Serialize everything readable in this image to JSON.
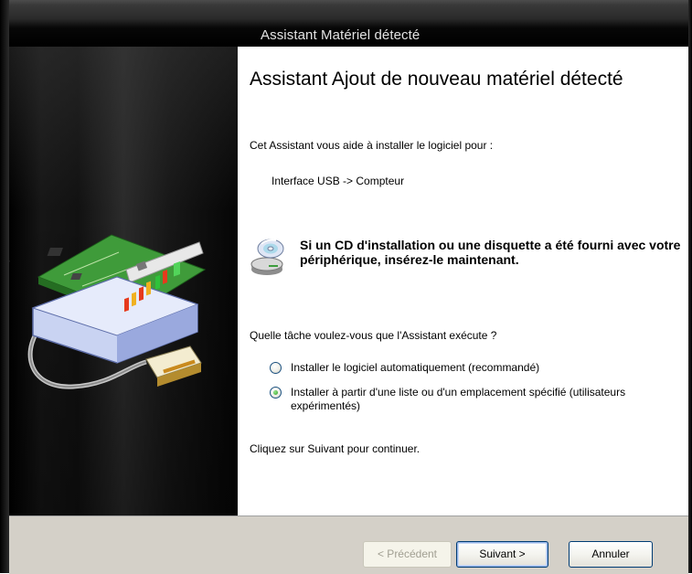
{
  "window": {
    "title": "Assistant Matériel détecté"
  },
  "content": {
    "heading": "Assistant Ajout de nouveau matériel détecté",
    "intro": "Cet Assistant vous aide à installer le logiciel pour :",
    "device_name": "Interface USB -> Compteur",
    "notice": "Si un CD d'installation ou une disquette a été fourni avec votre périphérique, insérez-le maintenant.",
    "question": "Quelle tâche voulez-vous que l'Assistant exécute ?",
    "options": [
      {
        "label": "Installer le logiciel automatiquement (recommandé)",
        "selected": false
      },
      {
        "label": "Installer à partir d'une liste ou d'un emplacement spécifié (utilisateurs expérimentés)",
        "selected": true
      }
    ],
    "outro": "Cliquez sur Suivant pour continuer."
  },
  "buttons": {
    "back": "< Précédent",
    "next": "Suivant >",
    "cancel": "Annuler"
  },
  "icons": {
    "banner": "hardware-device-icon",
    "notice": "cd-drive-icon"
  },
  "colors": {
    "title_bar": "#000000",
    "footer": "#d4d0c8",
    "button_border": "#003c74",
    "radio_selected": "#2e9d22"
  }
}
